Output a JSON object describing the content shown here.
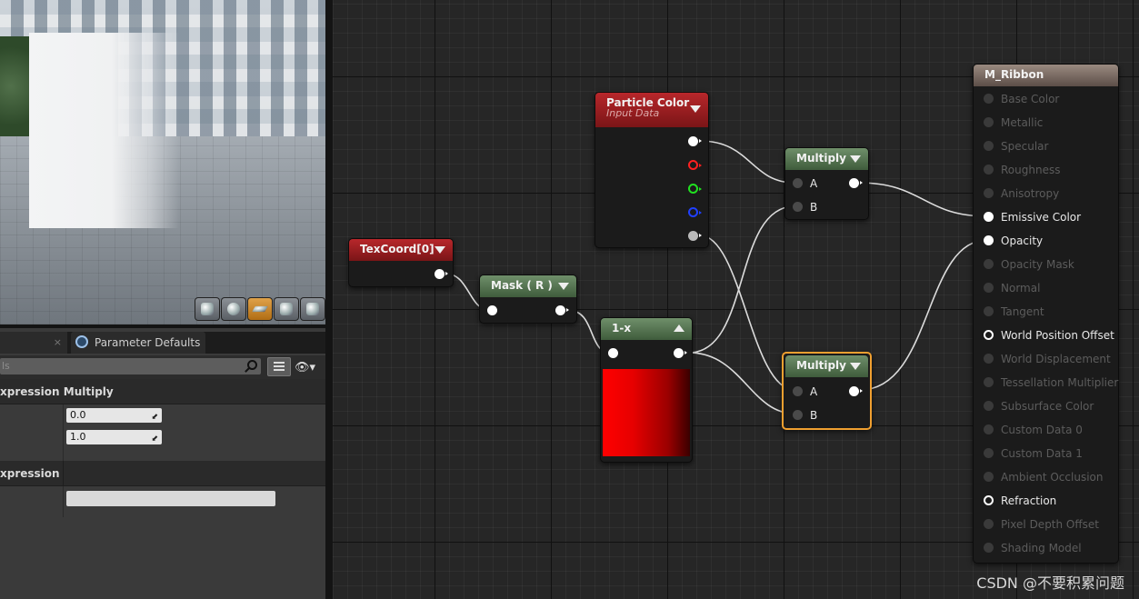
{
  "details": {
    "tab1_close": "×",
    "tab2_label": "Parameter Defaults",
    "tab2_close": "×",
    "search_placeholder": "ls",
    "section1": "xpression Multiply",
    "const_a": "0.0",
    "const_b": "1.0",
    "section2": "xpression"
  },
  "graph": {
    "texcoord": {
      "title": "TexCoord[0]"
    },
    "mask": {
      "title": "Mask ( R )"
    },
    "oneminus": {
      "title": "1-x"
    },
    "particle": {
      "title": "Particle Color",
      "subtitle": "Input Data"
    },
    "multiply1": {
      "title": "Multiply",
      "a": "A",
      "b": "B"
    },
    "multiply2": {
      "title": "Multiply",
      "a": "A",
      "b": "B"
    },
    "material": {
      "title": "M_Ribbon",
      "inputs": [
        "Base Color",
        "Metallic",
        "Specular",
        "Roughness",
        "Anisotropy",
        "Emissive Color",
        "Opacity",
        "Opacity Mask",
        "Normal",
        "Tangent",
        "World Position Offset",
        "World Displacement",
        "Tessellation Multiplier",
        "Subsurface Color",
        "Custom Data 0",
        "Custom Data 1",
        "Ambient Occlusion",
        "Refraction",
        "Pixel Depth Offset",
        "Shading Model"
      ]
    }
  },
  "watermark": "CSDN @不要积累问题",
  "colors": {
    "selection": "#f0a030",
    "red_header": "#b8272b",
    "green_header": "#6f8f6a",
    "pin_r": "#ff2020",
    "pin_g": "#20e020",
    "pin_b": "#2040ff"
  },
  "icons": [
    "perspective-icon",
    "sphere-preview-icon",
    "plane-preview-icon",
    "cube-preview-icon",
    "teapot-preview-icon",
    "parameter-defaults-icon",
    "search-icon",
    "list-view-icon",
    "eye-visibility-icon",
    "collapse-node-icon"
  ]
}
